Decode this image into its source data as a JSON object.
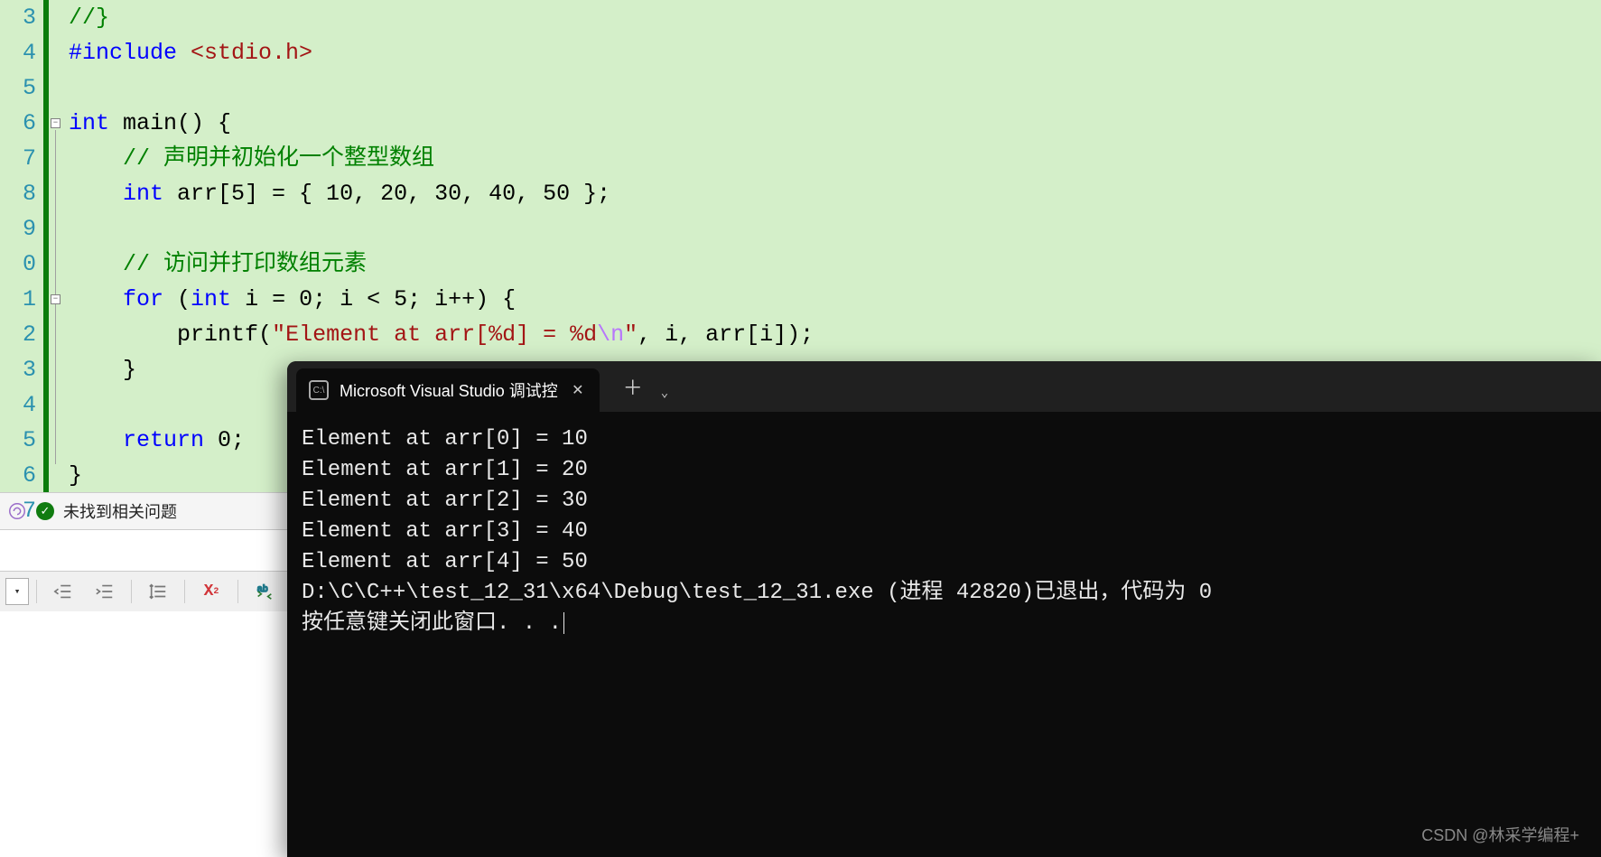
{
  "editor": {
    "line_numbers": [
      "3",
      "4",
      "5",
      "6",
      "7",
      "8",
      "9",
      "0",
      "1",
      "2",
      "3",
      "4",
      "5",
      "6",
      "7"
    ],
    "lines": [
      {
        "tokens": [
          {
            "cls": "comment",
            "t": "//}"
          }
        ],
        "indent": 0
      },
      {
        "tokens": [
          {
            "cls": "kw-blue",
            "t": "#include "
          },
          {
            "cls": "angle",
            "t": "<stdio.h>"
          }
        ],
        "indent": 0
      },
      {
        "tokens": [],
        "indent": 0
      },
      {
        "tokens": [
          {
            "cls": "kw-type",
            "t": "int"
          },
          {
            "cls": "txt",
            "t": " main() {"
          }
        ],
        "indent": 0
      },
      {
        "tokens": [
          {
            "cls": "comment",
            "t": "// 声明并初始化一个整型数组"
          }
        ],
        "indent": 1
      },
      {
        "tokens": [
          {
            "cls": "kw-type",
            "t": "int"
          },
          {
            "cls": "txt",
            "t": " arr[5] = { 10, 20, 30, 40, 50 };"
          }
        ],
        "indent": 1
      },
      {
        "tokens": [],
        "indent": 1
      },
      {
        "tokens": [
          {
            "cls": "comment",
            "t": "// 访问并打印数组元素"
          }
        ],
        "indent": 1
      },
      {
        "tokens": [
          {
            "cls": "kw-blue",
            "t": "for"
          },
          {
            "cls": "txt",
            "t": " ("
          },
          {
            "cls": "kw-type",
            "t": "int"
          },
          {
            "cls": "txt",
            "t": " i = 0; i < 5; i++) {"
          }
        ],
        "indent": 1
      },
      {
        "tokens": [
          {
            "cls": "txt",
            "t": "printf("
          },
          {
            "cls": "string",
            "t": "\"Element at arr[%d] = %d"
          },
          {
            "cls": "escape",
            "t": "\\n"
          },
          {
            "cls": "string",
            "t": "\""
          },
          {
            "cls": "txt",
            "t": ", i, arr[i]);"
          }
        ],
        "indent": 2
      },
      {
        "tokens": [
          {
            "cls": "txt",
            "t": "}"
          }
        ],
        "indent": 1
      },
      {
        "tokens": [],
        "indent": 1
      },
      {
        "tokens": [
          {
            "cls": "kw-blue",
            "t": "return"
          },
          {
            "cls": "txt",
            "t": " 0;"
          }
        ],
        "indent": 1
      },
      {
        "tokens": [
          {
            "cls": "txt",
            "t": "}"
          }
        ],
        "indent": 0
      },
      {
        "tokens": [],
        "indent": 0
      }
    ]
  },
  "issues_bar": {
    "text": "未找到相关问题"
  },
  "terminal": {
    "tab_title": "Microsoft Visual Studio 调试控",
    "output": [
      "Element at arr[0] = 10",
      "Element at arr[1] = 20",
      "Element at arr[2] = 30",
      "Element at arr[3] = 40",
      "Element at arr[4] = 50",
      "",
      "D:\\C\\C++\\test_12_31\\x64\\Debug\\test_12_31.exe (进程 42820)已退出，代码为 0",
      "按任意键关闭此窗口. . ."
    ]
  },
  "watermark": "CSDN @林采学编程+"
}
